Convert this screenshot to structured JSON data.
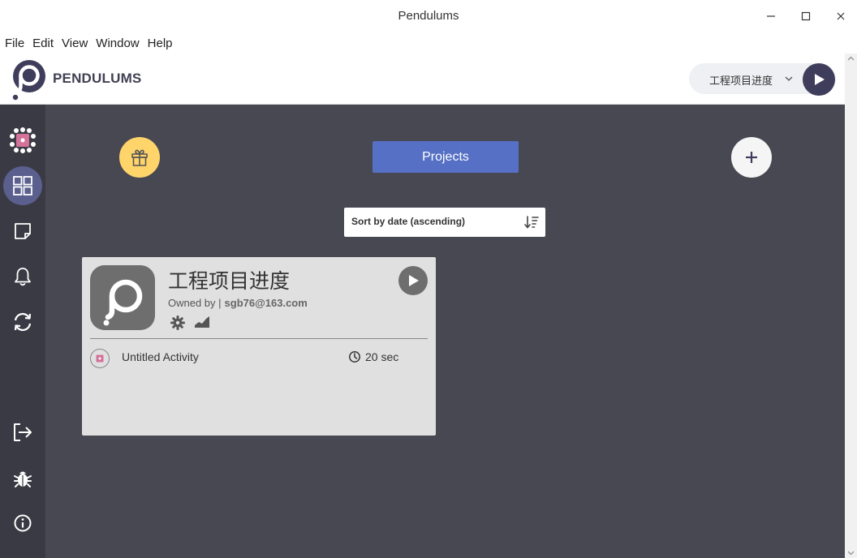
{
  "window": {
    "title": "Pendulums"
  },
  "menu": [
    "File",
    "Edit",
    "View",
    "Window",
    "Help"
  ],
  "header": {
    "brand": "PENDULUMS",
    "selected_project": "工程项目进度"
  },
  "main": {
    "projects_label": "Projects",
    "sort_label": "Sort by date (ascending)"
  },
  "project_card": {
    "title": "工程项目进度",
    "owner_prefix": "Owned by |",
    "owner_email": "sgb76@163.com",
    "activity": {
      "name": "Untitled Activity",
      "duration": "20 sec"
    }
  },
  "colors": {
    "sidebar": "#3a3a44",
    "main_bg": "#484853",
    "accent_blue": "#5570c4",
    "active_nav": "#5a5f8e",
    "gift_yellow": "#ffd46a",
    "brand_dark": "#3e3d5b",
    "activity_pink": "#d4739a"
  }
}
